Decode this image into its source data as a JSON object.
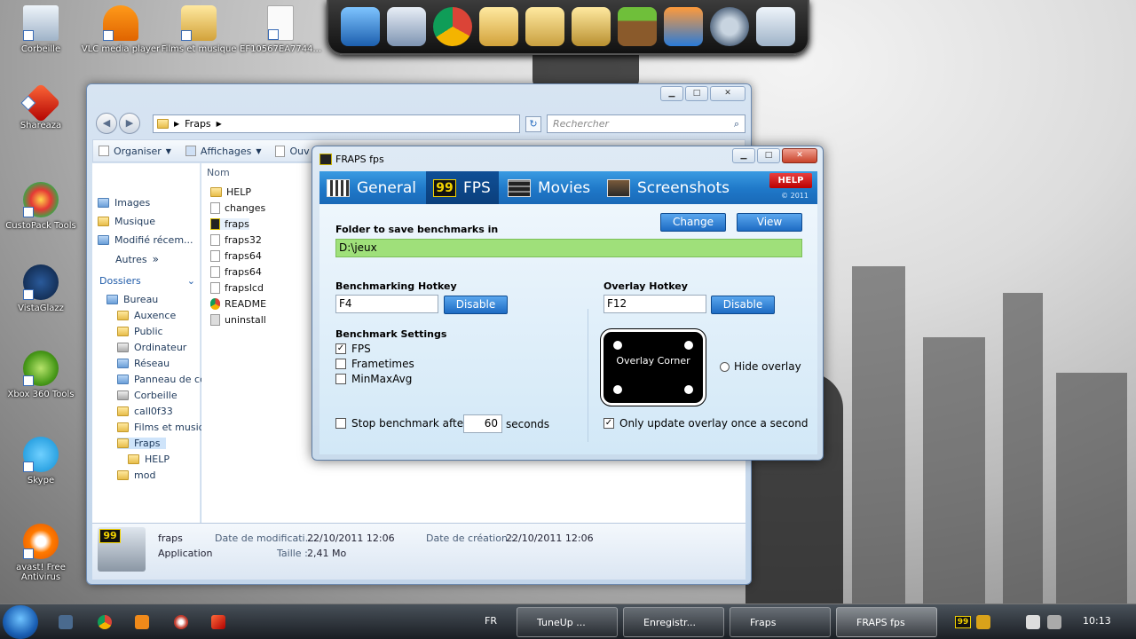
{
  "desktop": {
    "icons": [
      {
        "label": "Corbeille"
      },
      {
        "label": "VLC media player"
      },
      {
        "label": "Films et musique"
      },
      {
        "label": "EF10567EA7744..."
      },
      {
        "label": "Shareaza"
      },
      {
        "label": "CustoPack Tools"
      },
      {
        "label": "VistaGlazz"
      },
      {
        "label": "Xbox 360 Tools"
      },
      {
        "label": "Skype"
      },
      {
        "label": "avast! Free Antivirus"
      }
    ]
  },
  "explorer": {
    "minimize": "▁",
    "maximize": "□",
    "close": "✕",
    "back": "◀",
    "forward": "▶",
    "address": {
      "crumb": "Fraps",
      "sep": "▶"
    },
    "search_placeholder": "Rechercher",
    "toolbar": {
      "organize": "Organiser",
      "views": "Affichages",
      "open": "Ouv",
      "dropdown": "▼"
    },
    "nav": {
      "favorites": [
        "Images",
        "Musique",
        "Modifié récem..."
      ],
      "more": "Autres",
      "more_arrow": "»",
      "folders_heading": "Dossiers",
      "folders_arrow": "⌄",
      "tree": [
        {
          "label": "Bureau"
        },
        {
          "label": "Auxence"
        },
        {
          "label": "Public"
        },
        {
          "label": "Ordinateur"
        },
        {
          "label": "Réseau"
        },
        {
          "label": "Panneau de cc"
        },
        {
          "label": "Corbeille"
        },
        {
          "label": "call0f33"
        },
        {
          "label": "Films et musiq"
        },
        {
          "label": "Fraps"
        },
        {
          "label": "HELP"
        },
        {
          "label": "mod"
        }
      ]
    },
    "column_name": "Nom",
    "files": [
      "HELP",
      "changes",
      "fraps",
      "fraps32",
      "fraps64",
      "fraps64",
      "frapslcd",
      "README",
      "uninstall"
    ],
    "details": {
      "name": "fraps",
      "type": "Application",
      "modified_label": "Date de modificati...",
      "modified_value": "22/10/2011 12:06",
      "created_label": "Date de création :",
      "created_value": "22/10/2011 12:06",
      "size_label": "Taille :",
      "size_value": "2,41 Mo"
    }
  },
  "fraps": {
    "title": "FRAPS fps",
    "minimize": "▁",
    "maximize": "□",
    "close": "✕",
    "tabs": [
      {
        "label": "General"
      },
      {
        "label": "FPS",
        "icon_text": "99"
      },
      {
        "label": "Movies"
      },
      {
        "label": "Screenshots"
      }
    ],
    "help": "HELP",
    "copyright": "© 2011",
    "folder_label": "Folder to save benchmarks in",
    "folder_value": "D:\\jeux",
    "change": "Change",
    "view": "View",
    "bench_hotkey_label": "Benchmarking Hotkey",
    "bench_hotkey_value": "F4",
    "bench_disable": "Disable",
    "overlay_hotkey_label": "Overlay Hotkey",
    "overlay_hotkey_value": "F12",
    "overlay_disable": "Disable",
    "bench_settings_label": "Benchmark Settings",
    "opt_fps": "FPS",
    "opt_frametimes": "Frametimes",
    "opt_minmaxavg": "MinMaxAvg",
    "check_mark": "✓",
    "stop_label": "Stop benchmark after",
    "stop_value": "60",
    "seconds": "seconds",
    "overlay_corner": "Overlay Corner",
    "hide_overlay": "Hide overlay",
    "only_update": "Only update overlay once a second"
  },
  "taskbar": {
    "lang": "FR",
    "buttons": [
      {
        "label": "TuneUp ..."
      },
      {
        "label": "Enregistr..."
      },
      {
        "label": "Fraps"
      },
      {
        "label": "FRAPS fps"
      }
    ],
    "clock": "10:13",
    "tray_fps": "99"
  }
}
